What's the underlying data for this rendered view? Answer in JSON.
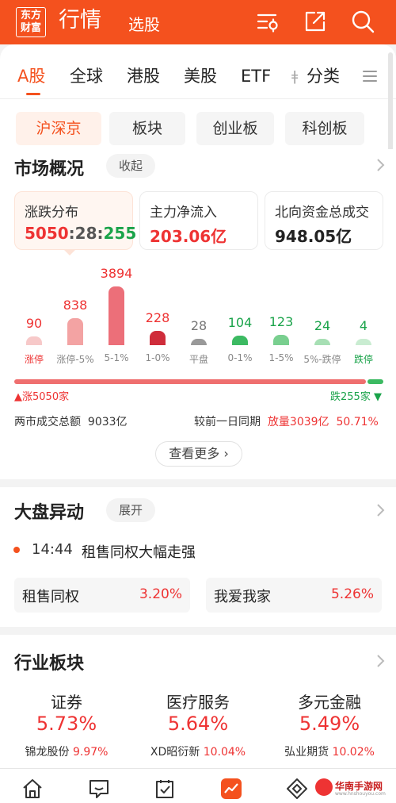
{
  "header": {
    "logo_line1": "东方",
    "logo_line2": "财富",
    "title": "行情",
    "subtitle": "选股"
  },
  "tabs": [
    {
      "label": "A股",
      "active": true
    },
    {
      "label": "全球"
    },
    {
      "label": "港股"
    },
    {
      "label": "美股"
    },
    {
      "label": "ETF"
    },
    {
      "label": "分类"
    }
  ],
  "subtabs": [
    {
      "label": "沪深京",
      "active": true
    },
    {
      "label": "板块"
    },
    {
      "label": "创业板"
    },
    {
      "label": "科创板"
    }
  ],
  "market": {
    "title": "市场概况",
    "collapse_label": "收起",
    "stats": [
      {
        "label": "涨跌分布",
        "up": "5050",
        "flat": "28",
        "down": "255"
      },
      {
        "label": "主力净流入",
        "value": "203.06亿"
      },
      {
        "label": "北向资金总成交",
        "value": "948.05亿"
      }
    ],
    "distribution": [
      {
        "count": "90",
        "label": "涨停",
        "value": 90,
        "side": "up"
      },
      {
        "count": "838",
        "label": "涨停-5%",
        "value": 838,
        "side": "up"
      },
      {
        "count": "3894",
        "label": "5-1%",
        "value": 3894,
        "side": "up"
      },
      {
        "count": "228",
        "label": "1-0%",
        "value": 228,
        "side": "up"
      },
      {
        "count": "28",
        "label": "平盘",
        "value": 28,
        "side": "flat"
      },
      {
        "count": "104",
        "label": "0-1%",
        "value": 104,
        "side": "down"
      },
      {
        "count": "123",
        "label": "1-5%",
        "value": 123,
        "side": "down"
      },
      {
        "count": "24",
        "label": "5%-跌停",
        "value": 24,
        "side": "down"
      },
      {
        "count": "4",
        "label": "跌停",
        "value": 4,
        "side": "down"
      }
    ],
    "up_label": "涨5050家",
    "down_label": "跌255家",
    "up_share": 0.952,
    "turnover_label": "两市成交总额",
    "turnover_value": "9033亿",
    "compare_label": "较前一日同期",
    "compare_value": "放量3039亿",
    "compare_pct": "50.71%",
    "more_label": "查看更多"
  },
  "dapan": {
    "title": "大盘异动",
    "expand_label": "展开",
    "event_time": "14:44",
    "event_text": "租售同权大幅走强",
    "chips": [
      {
        "name": "租售同权",
        "value": "3.20%"
      },
      {
        "name": "我爱我家",
        "value": "5.26%"
      }
    ]
  },
  "industry": {
    "title": "行业板块",
    "items": [
      {
        "name": "证券",
        "pct": "5.73%",
        "lead": "锦龙股份",
        "lead_pct": "9.97%"
      },
      {
        "name": "医疗服务",
        "pct": "5.64%",
        "lead": "XD昭衍新",
        "lead_pct": "10.04%"
      },
      {
        "name": "多元金融",
        "pct": "5.49%",
        "lead": "弘业期货",
        "lead_pct": "10.02%"
      }
    ]
  },
  "watermark": {
    "text": "华南手游网",
    "sub": "www.hnshouyou.com"
  },
  "colors": {
    "brand": "#f4511e",
    "up": "#e33333",
    "down": "#1aa34a"
  }
}
